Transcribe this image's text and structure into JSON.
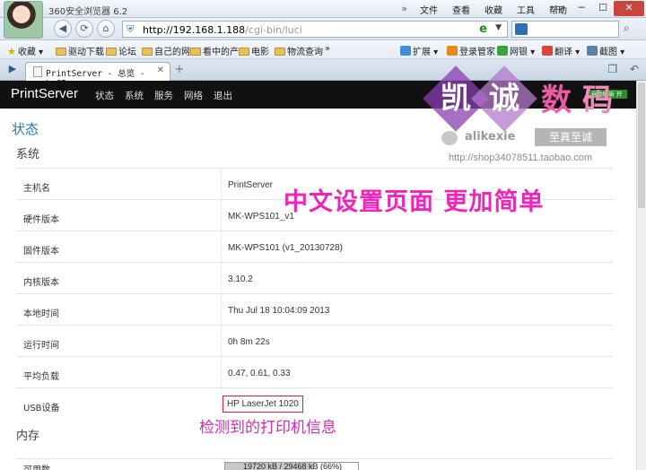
{
  "browser": {
    "app_title": "360安全浏览器 6.2",
    "menu": [
      "»",
      "文件",
      "查看",
      "收藏",
      "工具",
      "帮助"
    ],
    "window_controls": [
      "▭",
      "─",
      "☐",
      "✕"
    ],
    "url_host": "http://192.168.1.188",
    "url_path": "/cgi-bin/luci",
    "favorites": [
      {
        "icon": "star-icon",
        "label": "收藏 ▾"
      },
      {
        "icon": "folder-icon",
        "label": "驱动下载"
      },
      {
        "icon": "folder-icon",
        "label": "论坛"
      },
      {
        "icon": "folder-icon",
        "label": "自己的网"
      },
      {
        "icon": "folder-icon",
        "label": "看中的产"
      },
      {
        "icon": "folder-icon",
        "label": "电影"
      },
      {
        "icon": "folder-icon",
        "label": "物流查询"
      },
      {
        "icon": "chevron-right-icon",
        "label": "»"
      }
    ],
    "tools": [
      {
        "label": "扩展 ▾",
        "color": "#3c8fd6"
      },
      {
        "label": "登录管家",
        "color": "#e28a1c"
      },
      {
        "label": "网银 ▾",
        "color": "#3aa33a"
      },
      {
        "label": "翻译 ▾",
        "color": "#d9433b"
      },
      {
        "label": "截图 ▾",
        "color": "#5d7fa8"
      }
    ],
    "tab_label": "PrintServer - 总览 - LuCI"
  },
  "luci": {
    "brand": "PrintServer",
    "menu": [
      "状态",
      "系统",
      "服务",
      "网络",
      "退出"
    ],
    "auto_refresh": "自动刷新 开",
    "status_heading": "状态",
    "system_heading": "系统",
    "memory_heading": "内存",
    "system_rows": [
      {
        "key": "主机名",
        "value": "PrintServer"
      },
      {
        "key": "硬件版本",
        "value": "MK-WPS101_v1"
      },
      {
        "key": "固件版本",
        "value": "MK-WPS101 (v1_20130728)"
      },
      {
        "key": "内核版本",
        "value": "3.10.2"
      },
      {
        "key": "本地时间",
        "value": "Thu Jul 18 10:04:09 2013"
      },
      {
        "key": "运行时间",
        "value": "0h 8m 22s"
      },
      {
        "key": "平均负载",
        "value": "0.47, 0.61, 0.33"
      },
      {
        "key": "USB设备",
        "value": "HP LaserJet 1020"
      }
    ],
    "memory_row": {
      "key": "可用数",
      "text": "19720 kB / 29468 kB (66%)",
      "fraction": 0.66
    }
  },
  "overlay": {
    "watermark_chars": [
      "凯",
      "诚",
      "数",
      "码"
    ],
    "watermark_colors": [
      "#8a3fb0",
      "#b37acb",
      "#e93ea0",
      "#f07aae"
    ],
    "watermark_name": "alikexie",
    "watermark_slogan": "至真至诚",
    "watermark_url": "http://shop34078511.taobao.com",
    "promo_text": "中文设置页面  更加简单",
    "usb_note": "检测到的打印机信息"
  }
}
